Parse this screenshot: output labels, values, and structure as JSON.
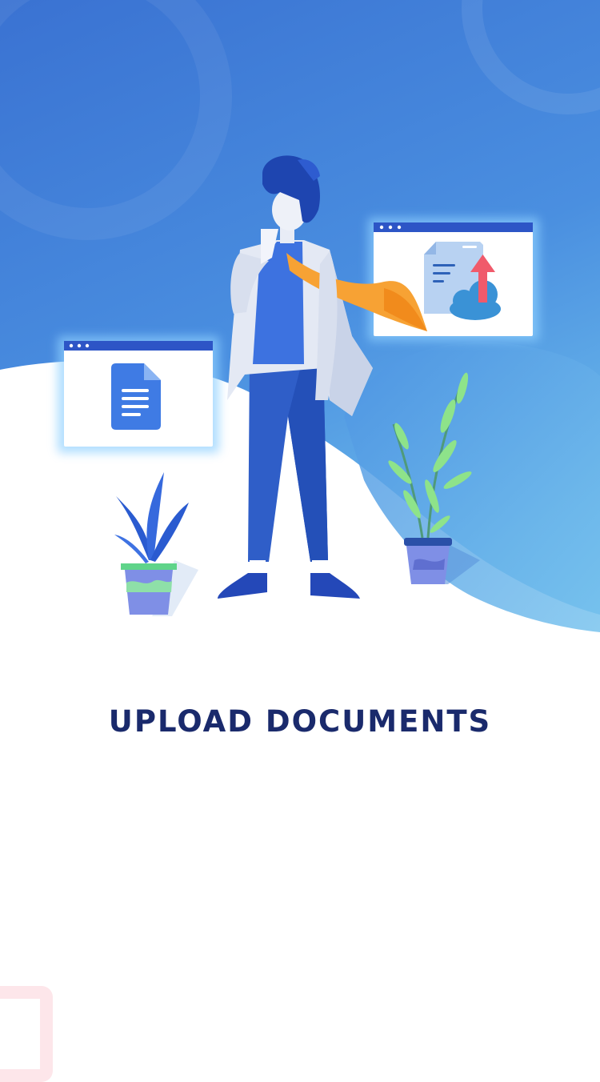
{
  "onboarding": {
    "title": "UPLOAD DOCUMENTS",
    "illustration_icons": [
      "document-window-icon",
      "cloud-upload-window-icon",
      "businessman-illustration",
      "plant-icon"
    ]
  },
  "colors": {
    "sky_top": "#3a74d3",
    "sky_bottom": "#6cb9ea",
    "title": "#1a2a6c",
    "suit": "#2f5ec8",
    "tie": "#f7a234",
    "upload_arrow": "#f05a6b",
    "doc_icon": "#3f7be4",
    "corner_frame": "#fde6ea"
  }
}
